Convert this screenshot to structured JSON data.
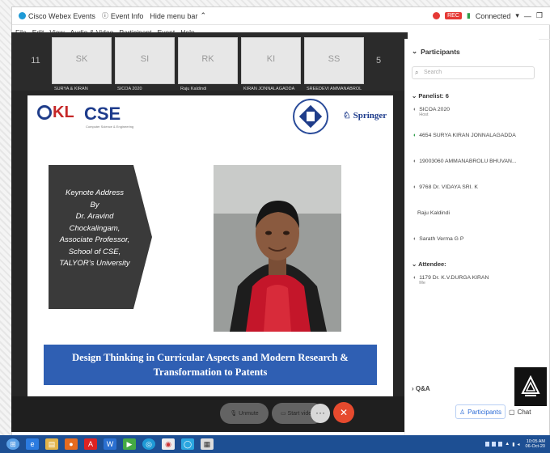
{
  "titlebar": {
    "app_title": "Cisco Webex Events",
    "events_label": "Event Info",
    "host_label": "Hide menu bar",
    "connection": "Connected",
    "badge": "REC"
  },
  "menu": [
    "File",
    "Edit",
    "View",
    "Audio & Video",
    "Participant",
    "Event",
    "Help"
  ],
  "thumbnails": [
    {
      "initials": "SK",
      "name": "SURYA & KIRAN"
    },
    {
      "initials": "SI",
      "name": "SICOA 2020"
    },
    {
      "initials": "RK",
      "name": "Raju Kaldindi"
    },
    {
      "initials": "KI",
      "name": "KIRAN JONNALAGADDA"
    },
    {
      "initials": "SS",
      "name": "SREEDEVI AMMANABROLU"
    }
  ],
  "thumb_nav": {
    "left": "11",
    "right": "5"
  },
  "slide": {
    "org_logo": "KL",
    "dept_logo": "CSE",
    "dept_sub": "Computer Science & Engineering",
    "publisher": "Springer",
    "keynote_lines": [
      "Keynote Address",
      "By",
      "Dr. Aravind Chockalingam,",
      "Associate Professor,",
      "School of CSE,",
      "TALYOR's University"
    ],
    "title_line1": "Design Thinking in Curricular Aspects and Modern Research &",
    "title_line2": "Transformation to Patents"
  },
  "controls": {
    "unmute": "Unmute",
    "video": "Start video",
    "more": "···",
    "end": "✕"
  },
  "panel": {
    "title": "Participants",
    "search_placeholder": "Search",
    "panelists_label": "Panelist: 6",
    "panelists": [
      {
        "name": "SICOA 2020",
        "sub": "Host",
        "tag": "Host"
      },
      {
        "name": "4654 SURYA KIRAN JONNALAGADDA",
        "sub": ""
      },
      {
        "name": "19003060 AMMANABROLU BHUVAN...",
        "sub": ""
      },
      {
        "name": "9768 Dr. VIDAYA SRI. K",
        "sub": ""
      },
      {
        "name": "Raju Kaldindi",
        "sub": ""
      },
      {
        "name": "Sarath Verma G P",
        "sub": ""
      }
    ],
    "attendees_label": "Attendee:",
    "attendees": [
      {
        "name": "1179 Dr. K.V.DURGA KIRAN",
        "sub": "Me"
      }
    ],
    "qna": "Q&A",
    "tab_participants": "Participants",
    "tab_chat": "Chat"
  },
  "taskbar": {
    "time": "10:05 AM",
    "date": "06-Oct-20"
  },
  "colors": {
    "banner": "#2f5fb3",
    "end_call": "#e64a2e",
    "taskbar": "#1d4f93"
  }
}
